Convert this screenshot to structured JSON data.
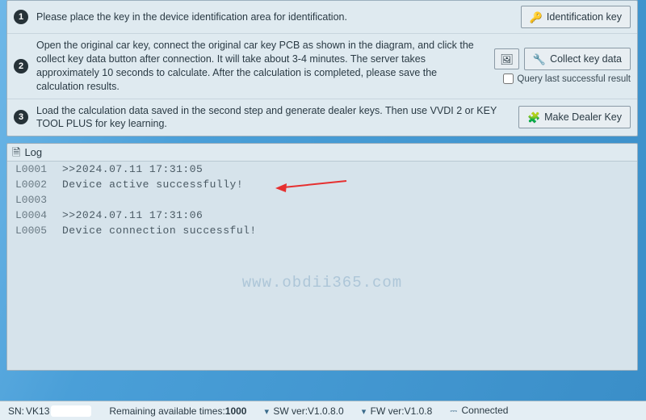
{
  "steps": [
    {
      "num": "1",
      "text": "Please place the key in the device identification area for identification.",
      "buttons": [
        "Identification key"
      ],
      "buttonIcons": [
        "🔑"
      ]
    },
    {
      "num": "2",
      "text": "Open the original car key, connect the original car key PCB as shown in the diagram, and click the collect key data button after connection. It will take about 3-4 minutes. The server takes approximately 10 seconds to calculate. After the calculation is completed, please save the calculation results.",
      "buttons": [
        "",
        "Collect key data"
      ],
      "buttonIcons": [
        "🖼",
        "🔧"
      ],
      "checkbox": "Query last successful result"
    },
    {
      "num": "3",
      "text": "Load the calculation data saved in the second step and generate dealer keys. Then use VVDI 2 or KEY TOOL PLUS for key learning.",
      "buttons": [
        "Make Dealer Key"
      ],
      "buttonIcons": [
        "🧩"
      ]
    }
  ],
  "log": {
    "title": "Log",
    "rows": [
      {
        "no": "L0001",
        "msg": ">>2024.07.11 17:31:05"
      },
      {
        "no": "L0002",
        "msg": "Device active successfully!"
      },
      {
        "no": "L0003",
        "msg": ""
      },
      {
        "no": "L0004",
        "msg": ">>2024.07.11 17:31:06"
      },
      {
        "no": "L0005",
        "msg": "Device connection successful!"
      }
    ],
    "watermark": "www.obdii365.com"
  },
  "status": {
    "sn_label": "SN: ",
    "sn_value": "VK13",
    "remaining_label": "Remaining available times:",
    "remaining_value": "1000",
    "sw_label": "SW ver:",
    "sw_value": "V1.0.8.0",
    "fw_label": "FW ver:",
    "fw_value": "V1.0.8",
    "connected": "Connected"
  }
}
